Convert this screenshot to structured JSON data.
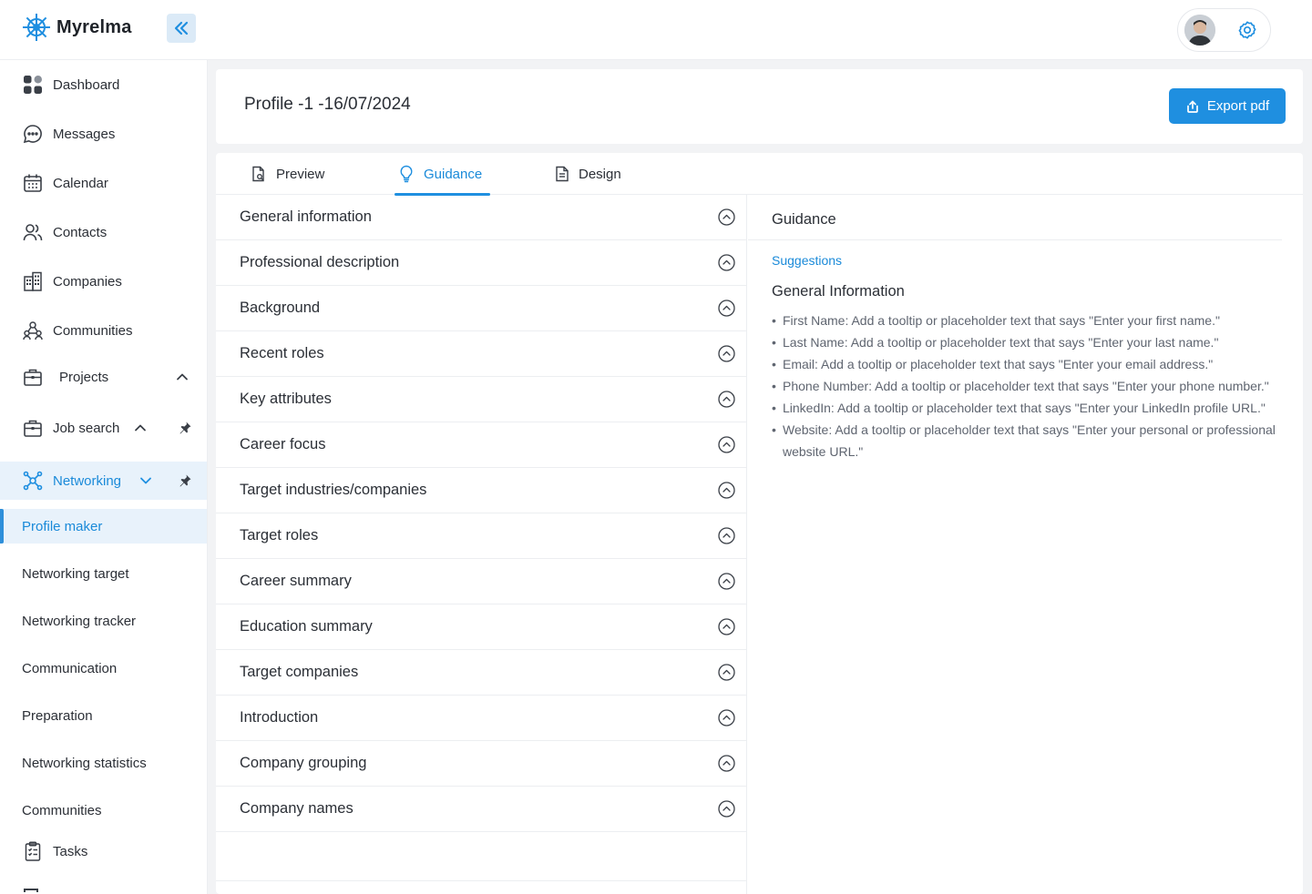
{
  "app": {
    "name": "Myrelma"
  },
  "header": {
    "title": "Profile -1 -16/07/2024",
    "export_label": "Export pdf"
  },
  "sidebar": {
    "items": [
      {
        "label": "Dashboard",
        "icon": "dashboard-icon"
      },
      {
        "label": "Messages",
        "icon": "chat-icon"
      },
      {
        "label": "Calendar",
        "icon": "calendar-icon"
      },
      {
        "label": "Contacts",
        "icon": "contacts-icon"
      },
      {
        "label": "Companies",
        "icon": "building-icon"
      },
      {
        "label": "Communities",
        "icon": "community-icon"
      },
      {
        "label": "Projects",
        "icon": "briefcase-icon"
      },
      {
        "label": "Job search",
        "icon": "briefcase-icon"
      },
      {
        "label": "Networking",
        "icon": "network-icon"
      },
      {
        "label": "Tasks",
        "icon": "clipboard-icon"
      }
    ],
    "networking_sub": [
      {
        "label": "Profile maker",
        "active": true
      },
      {
        "label": "Networking target"
      },
      {
        "label": "Networking tracker"
      },
      {
        "label": "Communication"
      },
      {
        "label": "Preparation"
      },
      {
        "label": "Networking statistics"
      },
      {
        "label": "Communities"
      }
    ]
  },
  "tabs": [
    {
      "label": "Preview"
    },
    {
      "label": "Guidance",
      "active": true
    },
    {
      "label": "Design"
    }
  ],
  "sections": [
    "General information",
    "Professional description",
    "Background",
    "Recent roles",
    "Key attributes",
    "Career focus",
    "Target industries/companies",
    "Target roles",
    "Career summary",
    "Education summary",
    "Target companies",
    "Introduction",
    "Company grouping",
    "Company names"
  ],
  "guidance": {
    "title": "Guidance",
    "suggestions_label": "Suggestions",
    "heading": "General Information",
    "bullets": [
      "First Name: Add a tooltip or placeholder text that says \"Enter your first name.\"",
      "Last Name: Add a tooltip or placeholder text that says \"Enter your last name.\"",
      "Email: Add a tooltip or placeholder text that says \"Enter your email address.\"",
      "Phone Number: Add a tooltip or placeholder text that says \"Enter your phone number.\"",
      "LinkedIn: Add a tooltip or placeholder text that says \"Enter your LinkedIn profile URL.\"",
      "Website: Add a tooltip or placeholder text that says \"Enter your personal or professional website URL.\""
    ]
  },
  "colors": {
    "accent": "#1f8fe0",
    "active_bg": "#e8f2fb",
    "text": "#2b2f36",
    "muted": "#5f6570"
  }
}
